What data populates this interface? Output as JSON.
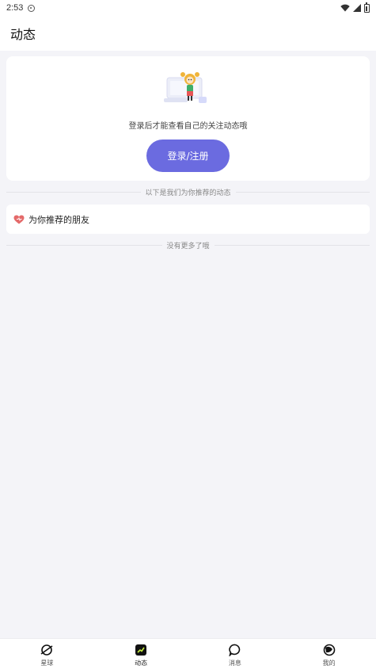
{
  "status_bar": {
    "time": "2:53"
  },
  "header": {
    "title": "动态"
  },
  "login_card": {
    "prompt": "登录后才能查看自己的关注动态哦",
    "button_label": "登录/注册"
  },
  "dividers": {
    "recommended_hint": "以下是我们为你推荐的动态",
    "end_hint": "没有更多了哦"
  },
  "recommend": {
    "label": "为你推荐的朋友"
  },
  "tabs": [
    {
      "label": "星球",
      "icon": "planet-icon"
    },
    {
      "label": "动态",
      "icon": "feed-icon",
      "active": true
    },
    {
      "label": "消息",
      "icon": "message-icon"
    },
    {
      "label": "我的",
      "icon": "profile-icon"
    }
  ],
  "colors": {
    "accent": "#6b6be0",
    "background": "#f4f4f8",
    "active_tab": "#c8f040",
    "heart": "#e46a6a"
  }
}
